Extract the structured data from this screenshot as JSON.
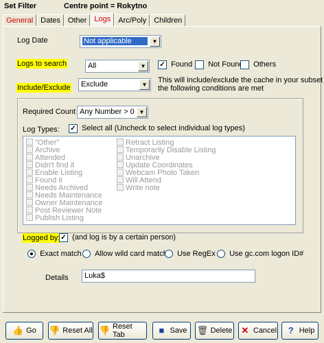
{
  "window": {
    "title": "Set Filter",
    "centre": "Centre point = Rokytno"
  },
  "tabs": [
    "General",
    "Dates",
    "Other",
    "Logs",
    "Arc/Poly",
    "Children"
  ],
  "log_date": {
    "label": "Log Date",
    "value": "Not applicable"
  },
  "logs_to_search": {
    "label": "Logs to search",
    "value": "All",
    "found": "Found",
    "not_found": "Not Found",
    "others": "Others"
  },
  "include_exclude": {
    "label": "Include/Exclude",
    "value": "Exclude",
    "note_line1": "This will include/exclude the cache in your subset if",
    "note_line2": "the following conditions are met"
  },
  "required_count": {
    "label": "Required Count",
    "value": "Any Number > 0"
  },
  "log_types": {
    "label": "Log Types:",
    "select_all": "Select all (Uncheck to select individual log types)",
    "col1": [
      "\"Other\"",
      "Archive",
      "Attended",
      "Didn't find it",
      "Enable Listing",
      "Found it",
      "Needs Archived",
      "Needs Maintenance",
      "Owner Maintenance",
      "Post Reviewer Note",
      "Publish Listing"
    ],
    "col2": [
      "Retract Listing",
      "Temporarily Disable Listing",
      "Unarchive",
      "Update Coordinates",
      "Webcam Photo Taken",
      "Will Attend",
      "Write note"
    ]
  },
  "logged_by": {
    "label": "Logged by:",
    "note": "(and log is by a certain person)"
  },
  "match": {
    "exact": "Exact match",
    "wild": "Allow wild card match",
    "regex": "Use RegEx",
    "gcid": "Use gc.com logon ID#"
  },
  "details": {
    "label": "Details",
    "value": "Luka$"
  },
  "buttons": {
    "go": "Go",
    "reset_all": "Reset All",
    "reset_tab": "Reset Tab",
    "save": "Save",
    "delete": "Delete",
    "cancel": "Cancel",
    "help": "Help"
  },
  "colors": {
    "highlight": "#ffff00",
    "tab_active": "#d40000",
    "selection": "#316ac5"
  }
}
